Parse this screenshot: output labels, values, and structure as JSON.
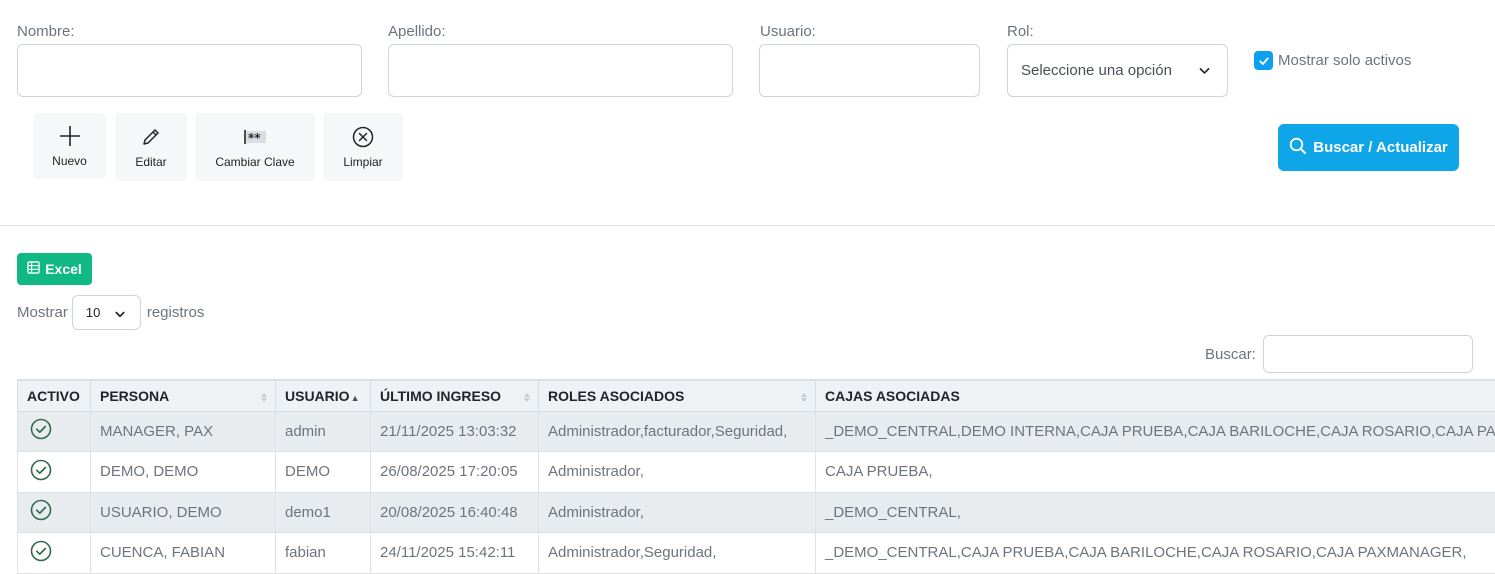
{
  "filters": {
    "nombre_label": "Nombre:",
    "apellido_label": "Apellido:",
    "usuario_label": "Usuario:",
    "rol_label": "Rol:",
    "rol_selected": "Seleccione una opción",
    "solo_activos_label": "Mostrar solo activos",
    "solo_activos_checked": true
  },
  "toolbar": {
    "nuevo": "Nuevo",
    "editar": "Editar",
    "cambiar_clave": "Cambiar Clave",
    "limpiar": "Limpiar"
  },
  "search_button": "Buscar / Actualizar",
  "excel_button": "Excel",
  "length": {
    "prefix": "Mostrar",
    "value": "10",
    "suffix": "registros"
  },
  "table_filter_label": "Buscar:",
  "columns": [
    "ACTIVO",
    "PERSONA",
    "USUARIO",
    "ÚLTIMO INGRESO",
    "ROLES ASOCIADOS",
    "CAJAS ASOCIADAS"
  ],
  "rows": [
    {
      "persona": "MANAGER, PAX",
      "usuario": "admin",
      "ultimo_ingreso": "21/11/2025 13:03:32",
      "roles": "Administrador,facturador,Seguridad,",
      "cajas": "_DEMO_CENTRAL,DEMO INTERNA,CAJA PRUEBA,CAJA BARILOCHE,CAJA ROSARIO,CAJA PAXMANAGER,"
    },
    {
      "persona": "DEMO, DEMO",
      "usuario": "DEMO",
      "ultimo_ingreso": "26/08/2025 17:20:05",
      "roles": "Administrador,",
      "cajas": "CAJA PRUEBA,"
    },
    {
      "persona": "USUARIO, DEMO",
      "usuario": "demo1",
      "ultimo_ingreso": "20/08/2025 16:40:48",
      "roles": "Administrador,",
      "cajas": "_DEMO_CENTRAL,"
    },
    {
      "persona": "CUENCA, FABIAN",
      "usuario": "fabian",
      "ultimo_ingreso": "24/11/2025 15:42:11",
      "roles": "Administrador,Seguridad,",
      "cajas": "_DEMO_CENTRAL,CAJA PRUEBA,CAJA BARILOCHE,CAJA ROSARIO,CAJA PAXMANAGER,"
    }
  ],
  "colors": {
    "primary": "#0ea5e9",
    "success": "#10b981",
    "active_icon": "#2f6b4a"
  },
  "icons": {
    "nuevo": "plus-icon",
    "editar": "pencil-icon",
    "cambiar_clave": "password-icon",
    "limpiar": "close-circle-icon",
    "search": "search-icon",
    "excel": "excel-icon",
    "active": "check-circle-icon"
  }
}
